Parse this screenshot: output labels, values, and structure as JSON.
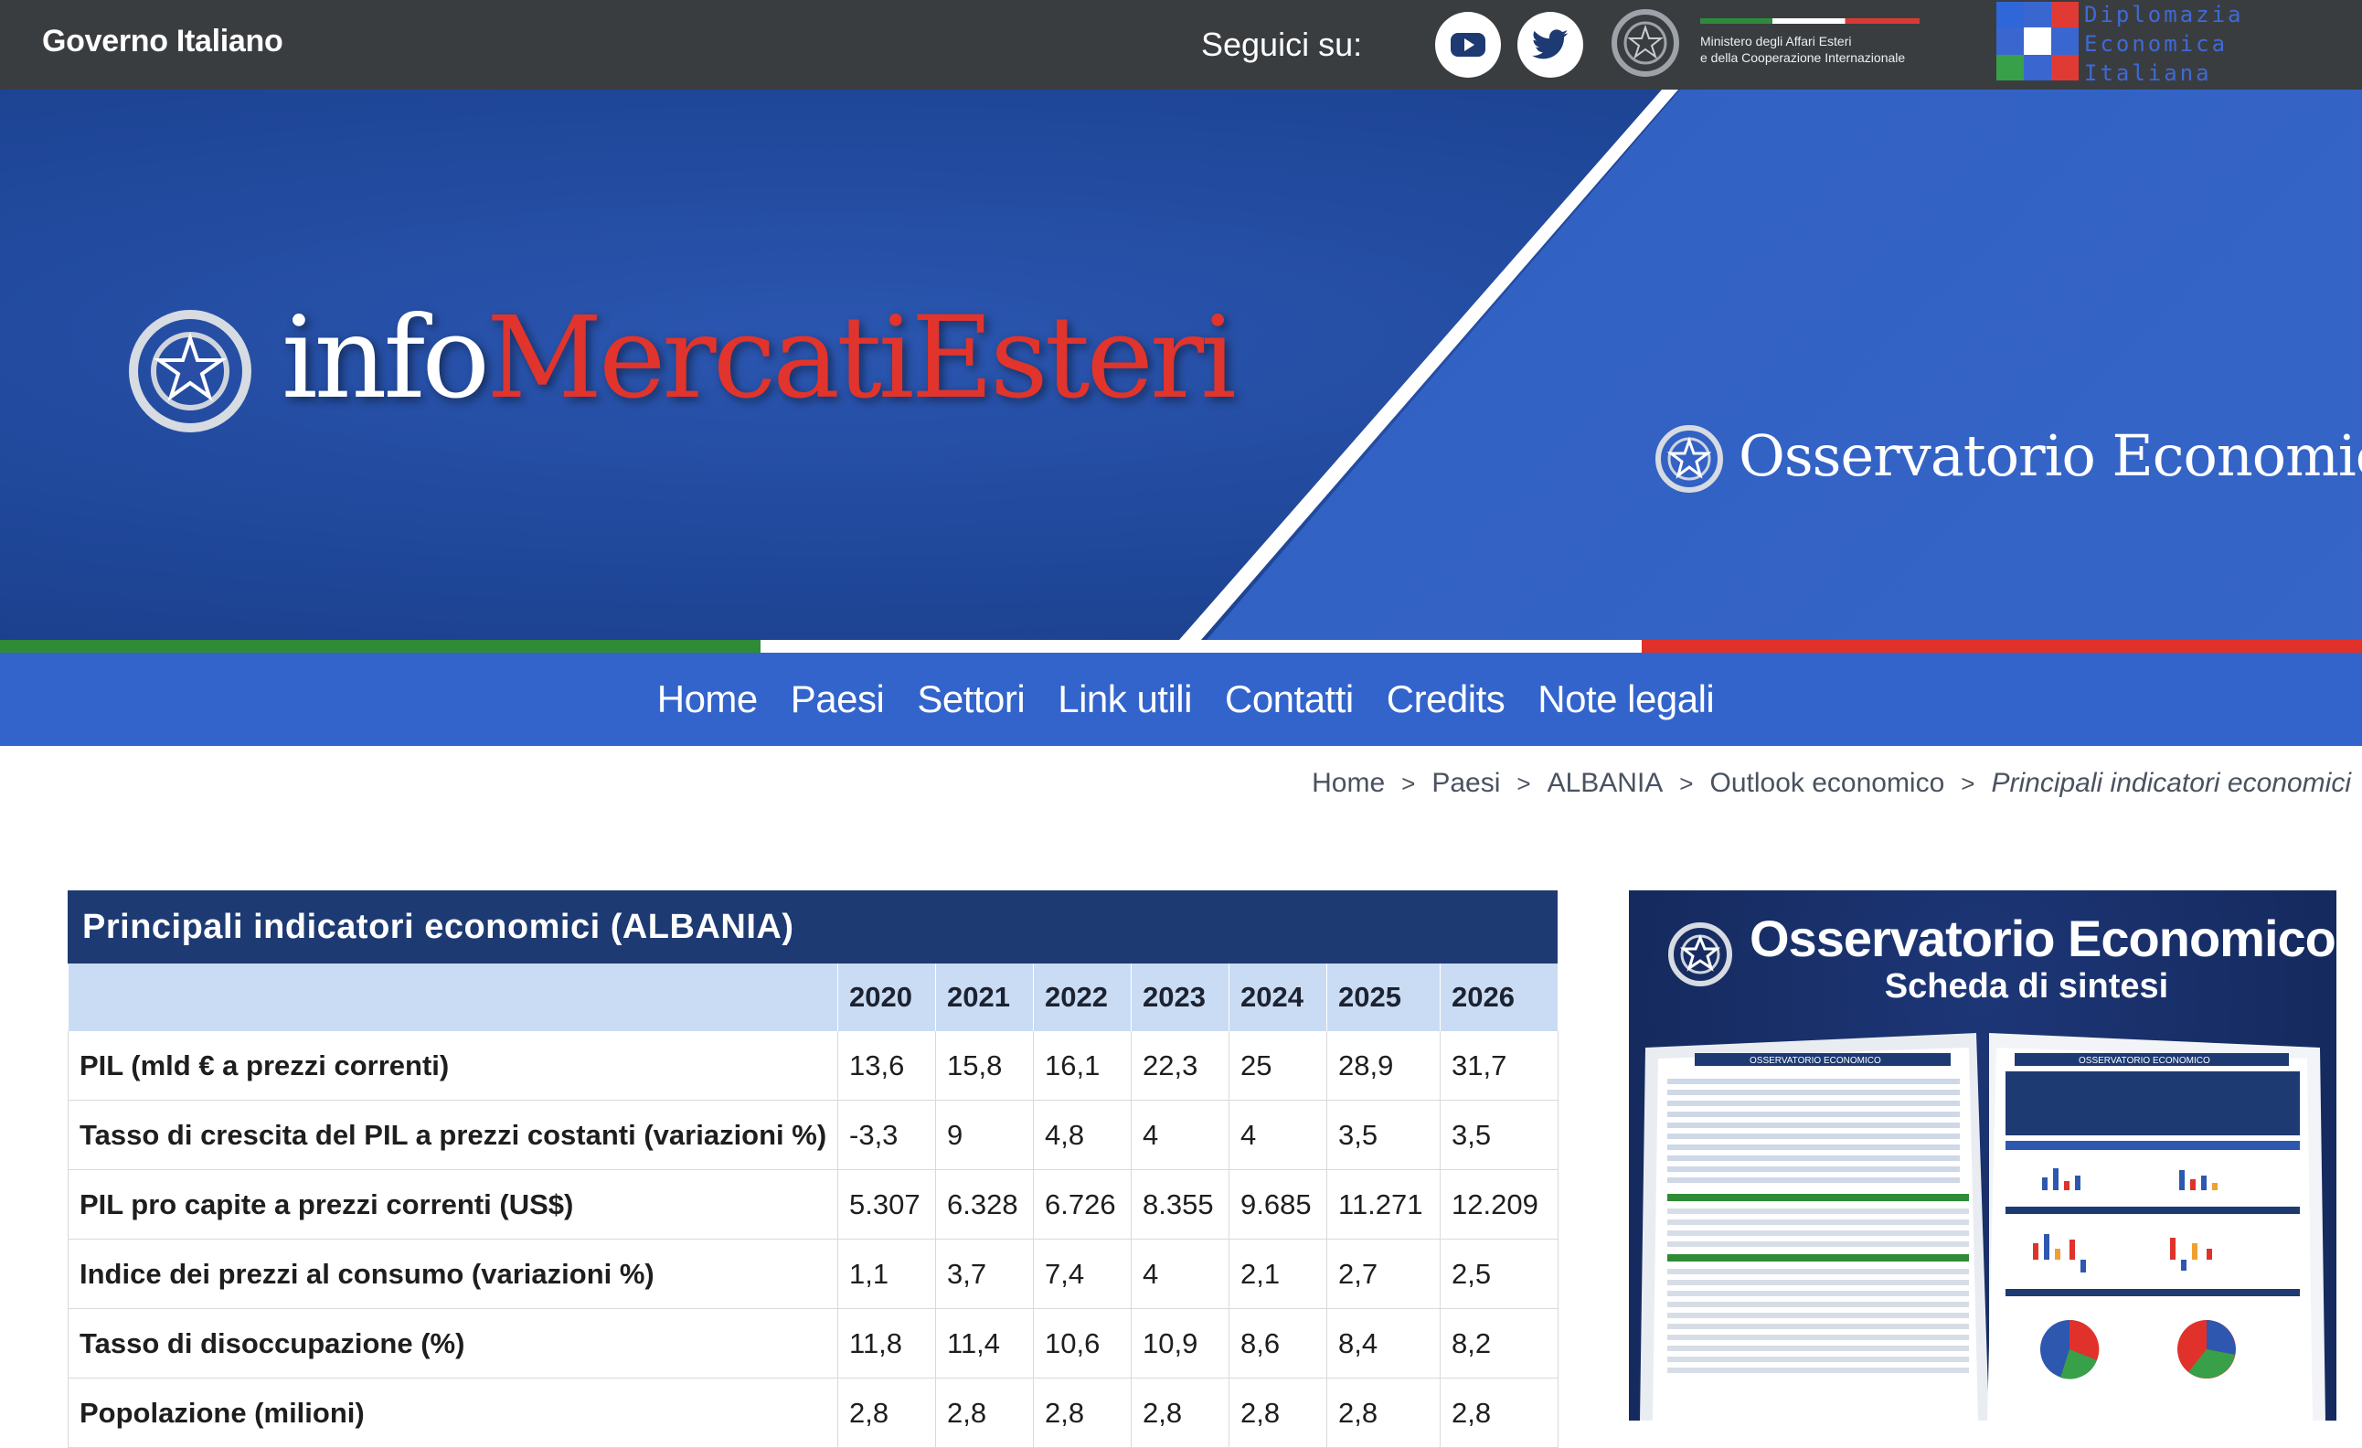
{
  "topbar": {
    "gov_label": "Governo Italiano",
    "follow_label": "Seguici su:",
    "social": [
      {
        "name": "youtube",
        "icon": "youtube-icon"
      },
      {
        "name": "twitter",
        "icon": "twitter-icon"
      }
    ],
    "mae_lines": [
      "Ministero degli Affari Esteri",
      "e della Cooperazione Internazionale"
    ],
    "dei_lines": [
      "Diplomazia",
      "Economica",
      "Italiana"
    ]
  },
  "hero": {
    "title_part1": "info",
    "title_part2": "MercatiEsteri",
    "right_title": "Osservatorio Economico"
  },
  "colors": {
    "dark_bar": "#3a3d40",
    "hero_blue": "#1f4799",
    "nav_blue": "#3264cc",
    "table_header": "#1d3a73",
    "table_subheader": "#c9dcf3",
    "italy_green": "#2f8b36",
    "italy_red": "#e0322b"
  },
  "nav": {
    "items": [
      "Home",
      "Paesi",
      "Settori",
      "Link utili",
      "Contatti",
      "Credits",
      "Note legali"
    ]
  },
  "breadcrumb": {
    "items": [
      "Home",
      "Paesi",
      "ALBANIA",
      "Outlook economico"
    ],
    "current": "Principali indicatori economici",
    "separator": ">"
  },
  "indicators": {
    "title": "Principali indicatori economici (ALBANIA)",
    "years": [
      "2020",
      "2021",
      "2022",
      "2023",
      "2024",
      "2025",
      "2026"
    ],
    "rows": [
      {
        "label": "PIL (mld € a prezzi correnti)",
        "values": [
          "13,6",
          "15,8",
          "16,1",
          "22,3",
          "25",
          "28,9",
          "31,7"
        ]
      },
      {
        "label": "Tasso di crescita del PIL a prezzi costanti (variazioni %)",
        "values": [
          "-3,3",
          "9",
          "4,8",
          "4",
          "4",
          "3,5",
          "3,5"
        ]
      },
      {
        "label": "PIL pro capite a prezzi correnti (US$)",
        "values": [
          "5.307",
          "6.328",
          "6.726",
          "8.355",
          "9.685",
          "11.271",
          "12.209"
        ]
      },
      {
        "label": "Indice dei prezzi al consumo (variazioni %)",
        "values": [
          "1,1",
          "3,7",
          "7,4",
          "4",
          "2,1",
          "2,7",
          "2,5"
        ]
      },
      {
        "label": "Tasso di disoccupazione (%)",
        "values": [
          "11,8",
          "11,4",
          "10,6",
          "10,9",
          "8,6",
          "8,4",
          "8,2"
        ]
      },
      {
        "label": "Popolazione (milioni)",
        "values": [
          "2,8",
          "2,8",
          "2,8",
          "2,8",
          "2,8",
          "2,8",
          "2,8"
        ]
      }
    ]
  },
  "promo": {
    "title": "Osservatorio Economico",
    "subtitle": "Scheda di sintesi",
    "page_header": "OSSERVATORIO ECONOMICO"
  }
}
